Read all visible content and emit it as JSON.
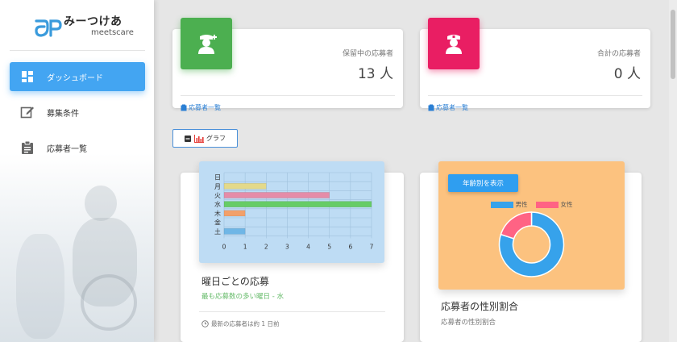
{
  "brand": {
    "name": "みーつけあ",
    "sub": "meetscare"
  },
  "sidebar": {
    "items": [
      {
        "label": "ダッシュボード",
        "icon": "dashboard-icon",
        "active": true
      },
      {
        "label": "募集条件",
        "icon": "edit-icon",
        "active": false
      },
      {
        "label": "応募者一覧",
        "icon": "clipboard-icon",
        "active": false
      }
    ]
  },
  "stats": [
    {
      "label": "保留中の応募者",
      "value": "13 人",
      "link": "応募者一覧",
      "icon": "nurse-add-icon",
      "color": "#4caf50"
    },
    {
      "label": "合計の応募者",
      "value": "0 人",
      "link": "応募者一覧",
      "icon": "nurse-icon",
      "color": "#e91e63"
    }
  ],
  "graph_toggle": {
    "label": "グラフ"
  },
  "weekday_card": {
    "title": "曜日ごとの応募",
    "subtitle": "最も応募数の多い曜日 - 水",
    "footer": "最新の応募者は約 1 日前"
  },
  "gender_card": {
    "button": "年齢別を表示",
    "title": "応募者の性別割合",
    "subtitle": "応募者の性別割合"
  },
  "colors": {
    "accent": "#43a5f2",
    "green": "#4caf50",
    "pink": "#e91e63",
    "orange": "#ffa726"
  },
  "chart_data": [
    {
      "type": "bar",
      "orientation": "horizontal",
      "categories": [
        "日",
        "月",
        "火",
        "水",
        "木",
        "金",
        "土"
      ],
      "values": [
        0,
        2,
        5,
        7,
        1,
        0,
        1
      ],
      "bar_colors": [
        "#9a9a9a",
        "#e3d98a",
        "#e58ca8",
        "#66cc66",
        "#f2a06a",
        "#9cc3e8",
        "#6fb6e6"
      ],
      "xticks": [
        "0",
        "1",
        "2",
        "3",
        "4",
        "5",
        "6",
        "7"
      ],
      "xlim": [
        0,
        7
      ],
      "grid": true
    },
    {
      "type": "pie",
      "variant": "doughnut",
      "labels": [
        "男性",
        "女性"
      ],
      "values": [
        80,
        20
      ],
      "colors": [
        "#36a2eb",
        "#ff6384"
      ],
      "legend": "top"
    }
  ]
}
